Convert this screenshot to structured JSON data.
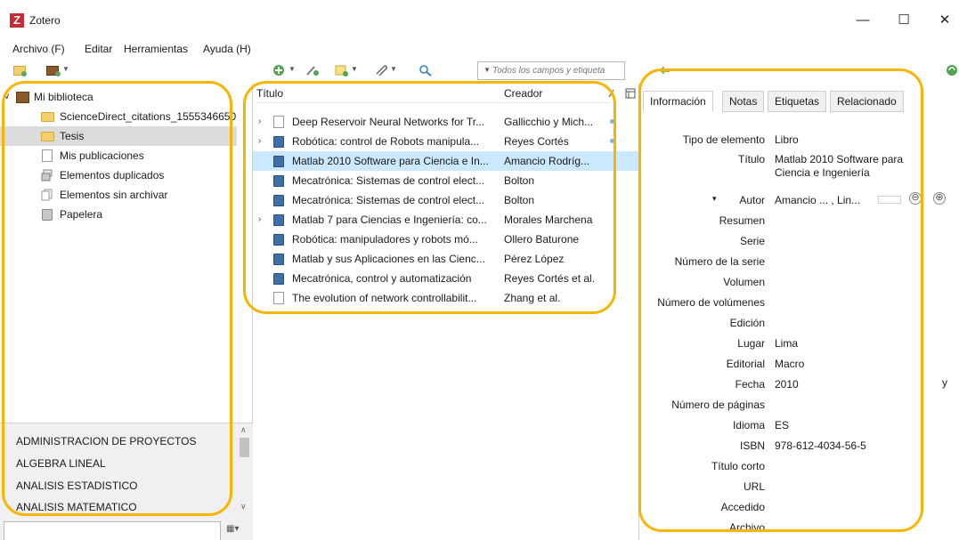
{
  "window": {
    "title": "Zotero",
    "controls": {
      "minimize": "—",
      "maximize": "☐",
      "close": "✕"
    }
  },
  "menu": {
    "archivo": "Archivo (F)",
    "editar": "Editar",
    "herramientas": "Herramientas",
    "ayuda": "Ayuda (H)"
  },
  "toolbar": {
    "search_placeholder": "Todos los campos y etiqueta",
    "icons": [
      "new-collection",
      "new-library",
      "new-item",
      "add-by-identifier",
      "new-note",
      "add-attachment",
      "advanced-search",
      "back-arrow",
      "sync"
    ]
  },
  "collections": {
    "library": "Mi biblioteca",
    "items": [
      {
        "label": "ScienceDirect_citations_1555346650...",
        "icon": "folder"
      },
      {
        "label": "Tesis",
        "icon": "folder",
        "selected": true
      },
      {
        "label": "Mis publicaciones",
        "icon": "document"
      },
      {
        "label": "Elementos duplicados",
        "icon": "duplicates"
      },
      {
        "label": "Elementos sin archivar",
        "icon": "unfiled"
      },
      {
        "label": "Papelera",
        "icon": "trash"
      }
    ]
  },
  "tags": [
    "ADMINISTRACION DE PROYECTOS",
    "ALGEBRA LINEAL",
    "ANALISIS ESTADISTICO",
    "ANALISIS MATEMATICO"
  ],
  "items_list": {
    "columns": {
      "title": "Título",
      "creator": "Creador"
    },
    "rows": [
      {
        "title": "Deep Reservoir Neural Networks for Tr...",
        "creator": "Gallicchio y Mich...",
        "type": "document",
        "expandable": true,
        "attachment": true
      },
      {
        "title": "Robótica: control de Robots manipula...",
        "creator": "Reyes Cortés",
        "type": "book",
        "expandable": true,
        "attachment": true
      },
      {
        "title": "Matlab 2010 Software para Ciencia e In...",
        "creator": "Amancio Rodríg...",
        "type": "book",
        "selected": true
      },
      {
        "title": "Mecatrónica: Sistemas de control elect...",
        "creator": "Bolton",
        "type": "book"
      },
      {
        "title": "Mecatrónica: Sistemas de control elect...",
        "creator": "Bolton",
        "type": "book"
      },
      {
        "title": "Matlab 7 para Ciencias e Ingeniería: co...",
        "creator": "Morales Marchena",
        "type": "book",
        "expandable": true
      },
      {
        "title": "Robótica: manipuladores y robots mó...",
        "creator": "Ollero Baturone",
        "type": "book"
      },
      {
        "title": "Matlab y sus Aplicaciones en las Cienc...",
        "creator": "Pérez López",
        "type": "book"
      },
      {
        "title": "Mecatrónica, control y automatización",
        "creator": "Reyes Cortés et al.",
        "type": "book"
      },
      {
        "title": "The evolution of network controllabilit...",
        "creator": "Zhang et al.",
        "type": "document"
      }
    ]
  },
  "item_pane": {
    "tabs": [
      "Información",
      "Notas",
      "Etiquetas",
      "Relacionado"
    ],
    "fields": [
      {
        "label": "Tipo de elemento",
        "value": "Libro"
      },
      {
        "label": "Título",
        "value": "Matlab 2010 Software para Ciencia e Ingeniería"
      },
      {
        "label": "Autor",
        "value": "Amancio ... , Lin..."
      },
      {
        "label": "Resumen",
        "value": ""
      },
      {
        "label": "Serie",
        "value": ""
      },
      {
        "label": "Número de la serie",
        "value": ""
      },
      {
        "label": "Volumen",
        "value": ""
      },
      {
        "label": "Número de volúmenes",
        "value": ""
      },
      {
        "label": "Edición",
        "value": ""
      },
      {
        "label": "Lugar",
        "value": "Lima"
      },
      {
        "label": "Editorial",
        "value": "Macro"
      },
      {
        "label": "Fecha",
        "value": "2010"
      },
      {
        "label": "Número de páginas",
        "value": ""
      },
      {
        "label": "Idioma",
        "value": "ES"
      },
      {
        "label": "ISBN",
        "value": "978-612-4034-56-5"
      },
      {
        "label": "Título corto",
        "value": ""
      },
      {
        "label": "URL",
        "value": ""
      },
      {
        "label": "Accedido",
        "value": ""
      },
      {
        "label": "Archivo",
        "value": ""
      }
    ],
    "date_hint": "y",
    "add_creator": "⊕",
    "remove_creator": "⊖",
    "creator_toggle": "▾"
  },
  "colors": {
    "highlight": "#f7b500",
    "selected_row": "#cce8ff",
    "zotero_red": "#cc2936"
  }
}
